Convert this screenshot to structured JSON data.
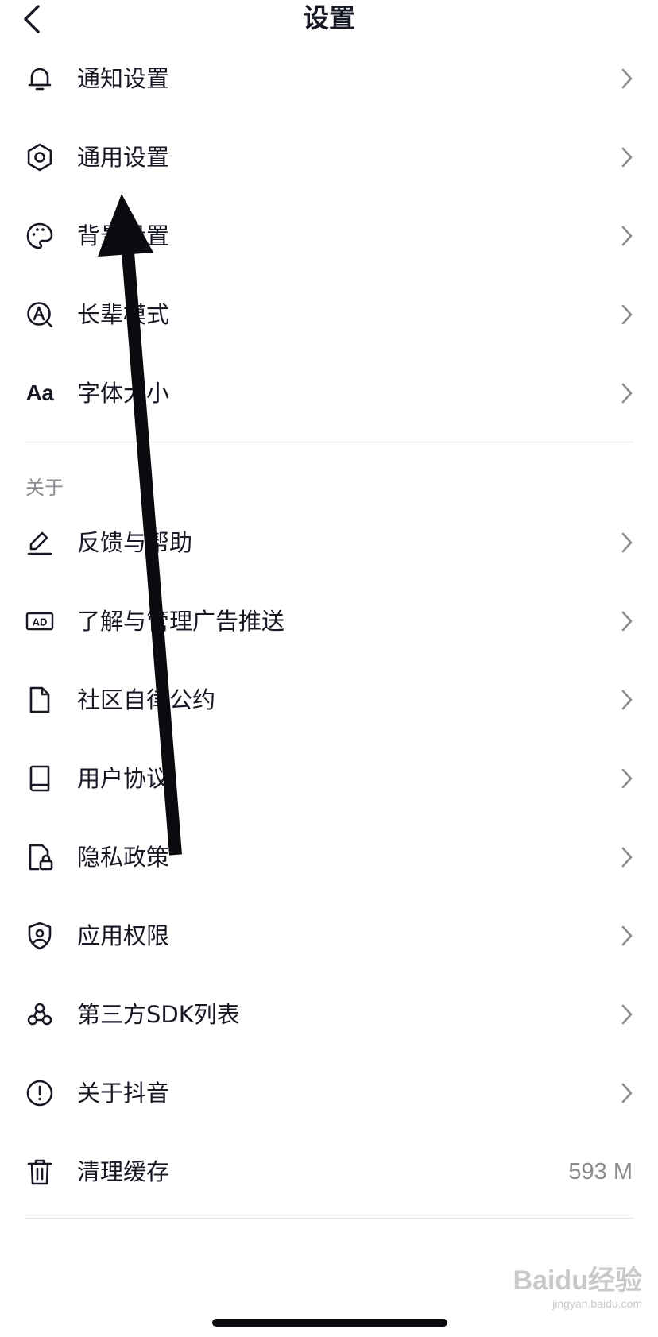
{
  "header": {
    "title": "设置",
    "back_icon": "chevron-left-icon"
  },
  "top_items": [
    {
      "label": "通知设置",
      "icon": "bell-icon"
    },
    {
      "label": "通用设置",
      "icon": "gear-icon"
    },
    {
      "label": "背景设置",
      "icon": "palette-icon"
    },
    {
      "label": "长辈模式",
      "icon": "elder-mode-icon"
    },
    {
      "label": "字体大小",
      "icon": "font-size-icon",
      "icon_text": "Aa"
    }
  ],
  "about": {
    "section_label": "关于",
    "items": [
      {
        "label": "反馈与帮助",
        "icon": "edit-icon"
      },
      {
        "label": "了解与管理广告推送",
        "icon": "ad-icon",
        "icon_text": "AD"
      },
      {
        "label": "社区自律公约",
        "icon": "document-icon"
      },
      {
        "label": "用户协议",
        "icon": "book-icon"
      },
      {
        "label": "隐私政策",
        "icon": "privacy-lock-icon"
      },
      {
        "label": "应用权限",
        "icon": "shield-icon"
      },
      {
        "label": "第三方SDK列表",
        "icon": "sdk-icon"
      },
      {
        "label": "关于抖音",
        "icon": "info-icon"
      },
      {
        "label": "清理缓存",
        "icon": "trash-icon",
        "value": "593 M"
      }
    ]
  },
  "watermark": {
    "brand": "Baidu经验",
    "url": "jingyan.baidu.com"
  }
}
